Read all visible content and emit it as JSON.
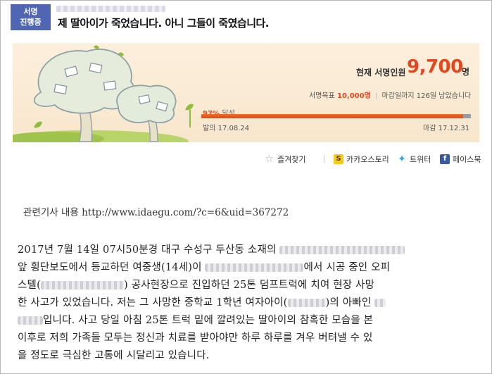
{
  "header": {
    "badge_line1": "서명",
    "badge_line2": "진행중",
    "title": "제 딸아이가 죽었습니다. 아니 그들이 죽였습니다."
  },
  "petition": {
    "count_label": "현재 서명인원",
    "count_value": "9,700",
    "count_unit": "명",
    "goal_label": "서명목표",
    "goal_value": "10,000명",
    "deadline_label": "마감일까지",
    "deadline_value": "126일",
    "deadline_suffix": "남았습니다",
    "progress_percent": 97,
    "progress_text": "97%",
    "progress_suffix": "달성",
    "start_label": "발의",
    "start_date": "17.08.24",
    "end_label": "마감",
    "end_date": "17.12.31",
    "accent_color": "#e2471e"
  },
  "share": {
    "favorite_label": "즐겨찾기",
    "kakao_label": "카카오스토리",
    "twitter_label": "트위터",
    "facebook_label": "페이스북"
  },
  "article": {
    "source_label": "관련기사 내용 http://www.idaegu.com/?c=6&uid=367272",
    "line1_a": "2017년 7월 14일 07시50분경 대구 수성구 두산동 소재의",
    "line2_a": "앞 횡단보도에서 등교하던 여중생(14세)이",
    "line2_b": "에서 시공 중인 오피",
    "line3_a": "스텔(",
    "line3_b": ") 공사현장으로 진입하던 25톤 덤프트럭에 치여 현장 사망",
    "line4_a": "한 사고가 있었습니다. 저는 그 사망한 중학교 1학년 여자아이(",
    "line4_b": ")의 아빠인",
    "line5_a": "입니다. 사고 당일 아침 25톤 트럭 밑에 깔려있는 딸아이의 참혹한 모습을 본",
    "line6_a": "이후로 저희 가족들 모두는 정신과 치료를 받아야만 하루 하루를 겨우 버텨낼 수 있",
    "line7_a": "을 정도로 극심한 고통에 시달리고 있습니다."
  }
}
